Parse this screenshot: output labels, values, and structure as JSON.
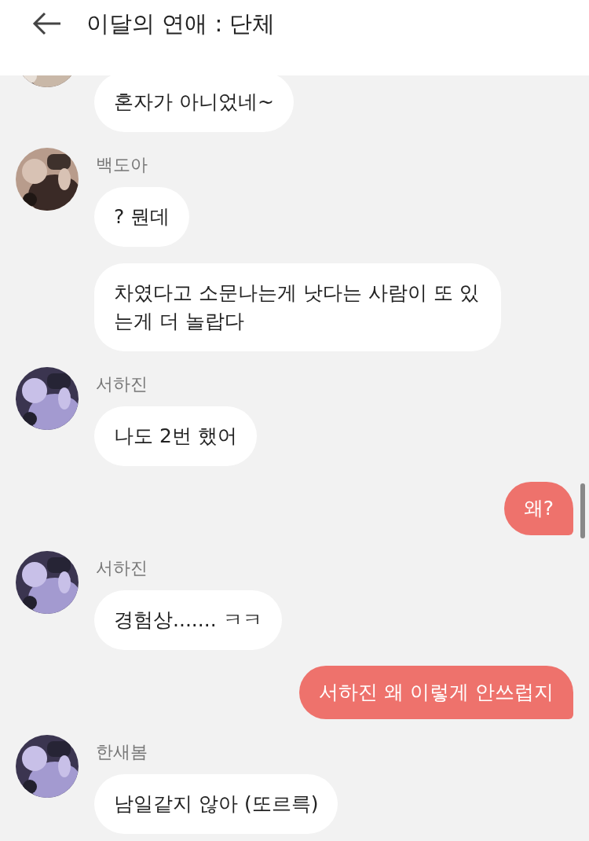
{
  "header": {
    "title": "이달의 연애 : 단체"
  },
  "messages": [
    {
      "kind": "received",
      "bubbles": [
        "혼자가 아니었네~"
      ]
    },
    {
      "kind": "received",
      "sender": "백도아",
      "bubbles": [
        "? 뭔데",
        "차였다고 소문나는게 낫다는 사람이 또 있는게 더 놀랍다"
      ]
    },
    {
      "kind": "received",
      "sender": "서하진",
      "bubbles": [
        "나도 2번 했어"
      ]
    },
    {
      "kind": "sent",
      "bubbles": [
        "왜?"
      ]
    },
    {
      "kind": "received",
      "sender": "서하진",
      "bubbles": [
        "경험상....... ㅋㅋ"
      ]
    },
    {
      "kind": "sent",
      "bubbles": [
        "서하진 왜 이렇게 안쓰럽지"
      ]
    },
    {
      "kind": "received",
      "sender": "한새봄",
      "bubbles": [
        "남일같지 않아 (또르륵)"
      ]
    }
  ]
}
